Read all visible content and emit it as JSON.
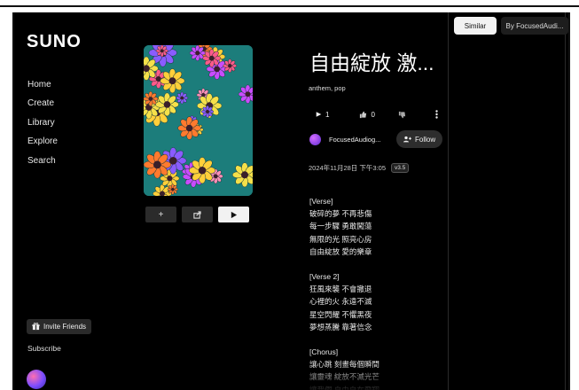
{
  "app": {
    "logo": "SUNO"
  },
  "sidebar": {
    "items": [
      {
        "label": "Home"
      },
      {
        "label": "Create"
      },
      {
        "label": "Library"
      },
      {
        "label": "Explore"
      },
      {
        "label": "Search"
      }
    ],
    "invite_label": "Invite Friends",
    "subscribe_label": "Subscribe"
  },
  "player_controls": {
    "add": "+",
    "share": "share-icon",
    "play": "play-icon"
  },
  "song": {
    "title": "自由綻放 激...",
    "tags": "anthem, pop",
    "plays": "1",
    "likes": "0",
    "artist": "FocusedAudiog...",
    "follow_label": "Follow",
    "date": "2024年11月28日 下午3:05",
    "version": "v3.5"
  },
  "lyrics": [
    "[Verse]",
    "破碎的夢 不再悲傷",
    "每一步驟 勇敢闖蕩",
    "無限的光 照亮心房",
    "自由綻放 愛的樂章",
    "",
    "[Verse 2]",
    "狂風來襲 不會撤退",
    "心裡的火 永遠不滅",
    "星空閃耀 不懼黑夜",
    "夢想蒸騰 靠著信念",
    "",
    "[Chorus]",
    "讓心跳 刻畫每個瞬間",
    "讓靈魂 綻放不滅光芒",
    "讓我們 自由自在飛翔"
  ],
  "right_panel": {
    "tabs": [
      {
        "label": "Similar"
      },
      {
        "label": "By FocusedAudi..."
      }
    ]
  },
  "colors": {
    "background": "#000000",
    "accent": "#f2f2f2"
  }
}
